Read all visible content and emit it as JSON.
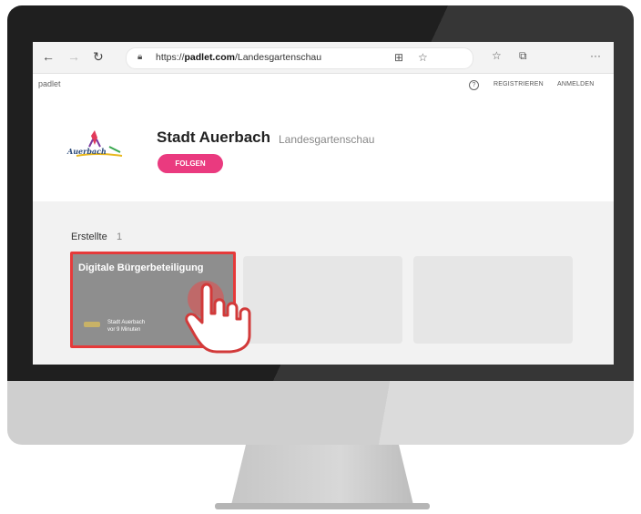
{
  "browser": {
    "url_prefix": "https://",
    "url_domain": "padlet.com",
    "url_path": "/Landesgartenschau",
    "back_icon": "arrow-left",
    "forward_icon": "arrow-right",
    "refresh_icon": "refresh",
    "menu_dots": "···"
  },
  "header": {
    "brand": "padlet",
    "register": "REGISTRIEREN",
    "login": "ANMELDEN",
    "help": "?"
  },
  "profile": {
    "name": "Stadt Auerbach",
    "subtitle": "Landesgartenschau",
    "follow_label": "FOLGEN",
    "logo_text": "Auerbach"
  },
  "section": {
    "title": "Erstellte",
    "count": "1"
  },
  "cards": [
    {
      "title": "Digitale Bürgerbeteiligung",
      "author": "Stadt Auerbach",
      "time": "vor 9 Minuten"
    }
  ],
  "colors": {
    "accent": "#ea3a7f",
    "highlight": "#e63a3a",
    "card_active": "#8e8e8e"
  }
}
